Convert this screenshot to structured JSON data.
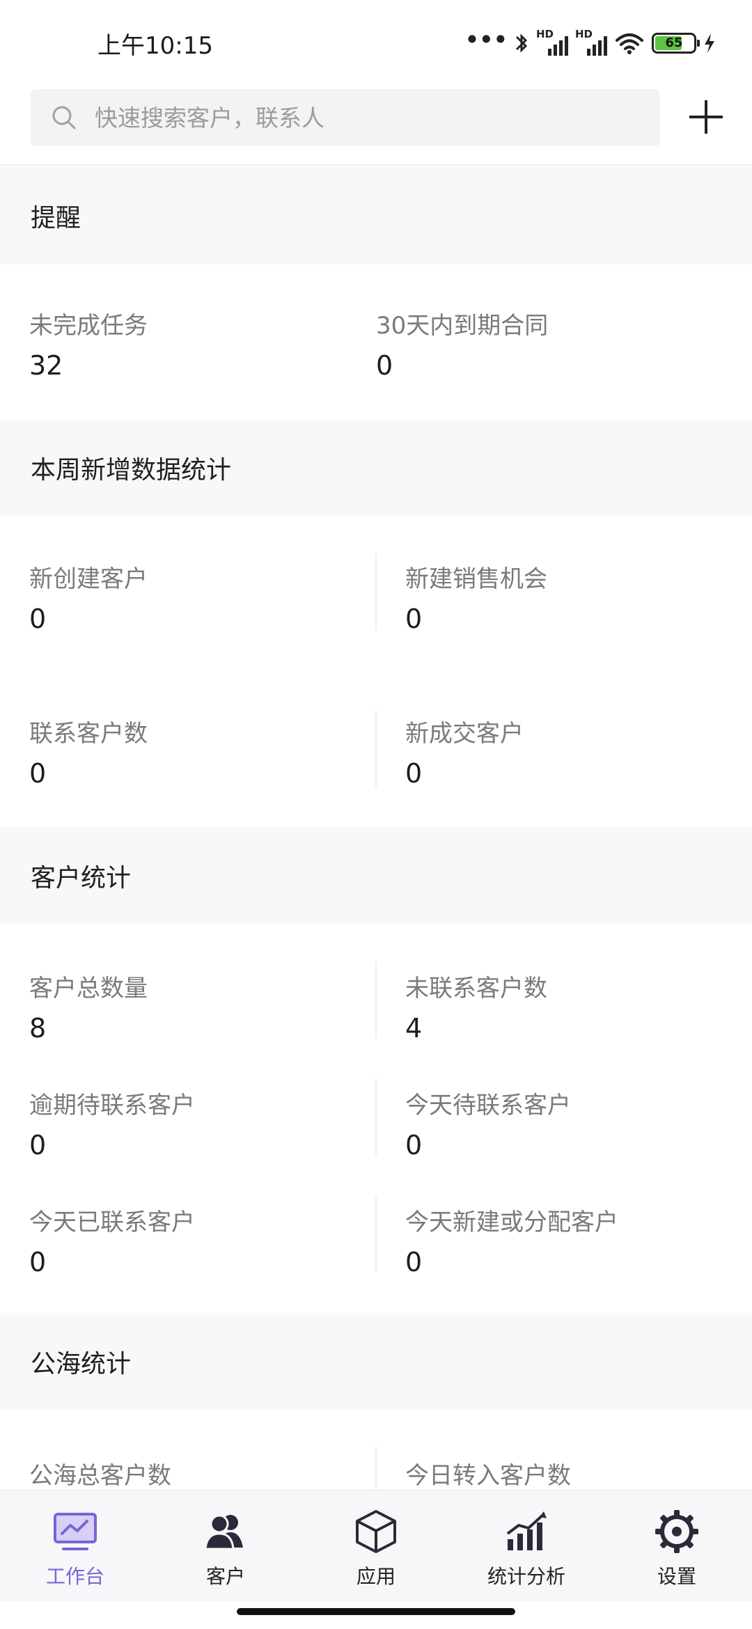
{
  "status_bar": {
    "time": "上午10:15",
    "battery": "65",
    "hd_label": "HD"
  },
  "search": {
    "placeholder": "快速搜索客户，联系人"
  },
  "reminders": {
    "title": "提醒",
    "items": [
      {
        "label": "未完成任务",
        "value": "32"
      },
      {
        "label": "30天内到期合同",
        "value": "0"
      }
    ]
  },
  "weekly": {
    "title": "本周新增数据统计",
    "items": [
      {
        "label": "新创建客户",
        "value": "0"
      },
      {
        "label": "新建销售机会",
        "value": "0"
      },
      {
        "label": "联系客户数",
        "value": "0"
      },
      {
        "label": "新成交客户",
        "value": "0"
      }
    ]
  },
  "customer_stats": {
    "title": "客户统计",
    "items": [
      {
        "label": "客户总数量",
        "value": "8"
      },
      {
        "label": "未联系客户数",
        "value": "4"
      },
      {
        "label": "逾期待联系客户",
        "value": "0"
      },
      {
        "label": "今天待联系客户",
        "value": "0"
      },
      {
        "label": "今天已联系客户",
        "value": "0"
      },
      {
        "label": "今天新建或分配客户",
        "value": "0"
      }
    ]
  },
  "public_pool": {
    "title": "公海统计",
    "items": [
      {
        "label": "公海总客户数"
      },
      {
        "label": "今日转入客户数"
      }
    ]
  },
  "bottom_nav": [
    {
      "label": "工作台",
      "icon": "monitor-chart-icon",
      "active": true
    },
    {
      "label": "客户",
      "icon": "people-icon",
      "active": false
    },
    {
      "label": "应用",
      "icon": "cube-icon",
      "active": false
    },
    {
      "label": "统计分析",
      "icon": "bar-chart-icon",
      "active": false
    },
    {
      "label": "设置",
      "icon": "gear-icon",
      "active": false
    }
  ],
  "colors": {
    "accent": "#7a63d6",
    "section_bg": "#f7f8f9",
    "search_bg": "#f2f3f5"
  }
}
